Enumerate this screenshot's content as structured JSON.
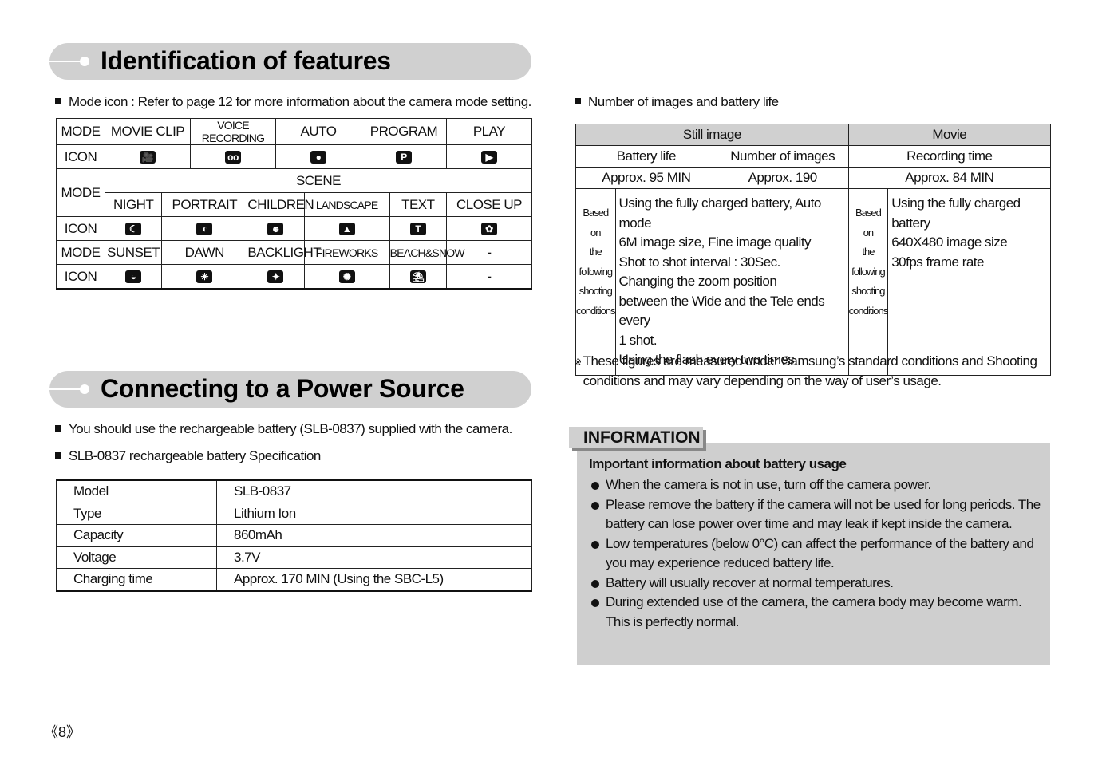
{
  "section1": {
    "title": "Identification of features",
    "bullet": "Mode icon : Refer to page 12 for more information about the camera mode setting."
  },
  "mode_table": {
    "row1": {
      "label": "MODE",
      "cells": [
        "MOVIE CLIP",
        "VOICE RECORDING",
        "AUTO",
        "PROGRAM",
        "PLAY"
      ]
    },
    "row2": {
      "label": "ICON",
      "icons": [
        "movie-clip-icon",
        "voice-recording-icon",
        "auto-camera-icon",
        "program-camera-icon",
        "play-icon"
      ]
    },
    "scene": {
      "label": "MODE",
      "header": "SCENE",
      "cells": [
        "NIGHT",
        "PORTRAIT",
        "CHILDREN",
        "LANDSCAPE",
        "TEXT",
        "CLOSE UP"
      ]
    },
    "row4": {
      "label": "ICON",
      "icons": [
        "night-icon",
        "portrait-icon",
        "children-icon",
        "landscape-icon",
        "text-icon",
        "close-up-icon"
      ]
    },
    "row5": {
      "label": "MODE",
      "cells": [
        "SUNSET",
        "DAWN",
        "BACKLIGHT",
        "FIREWORKS",
        "BEACH&SNOW",
        "-"
      ]
    },
    "row6": {
      "label": "ICON",
      "icons": [
        "sunset-icon",
        "dawn-icon",
        "backlight-icon",
        "fireworks-icon",
        "beach-snow-icon"
      ],
      "last": "-"
    }
  },
  "section2": {
    "title": "Connecting to a Power Source",
    "bullets": [
      "You should use the rechargeable battery (SLB-0837) supplied with the camera.",
      "SLB-0837 rechargeable battery Specification"
    ]
  },
  "spec_table": [
    [
      "Model",
      "SLB-0837"
    ],
    [
      "Type",
      "Lithium Ion"
    ],
    [
      "Capacity",
      "860mAh"
    ],
    [
      "Voltage",
      "3.7V"
    ],
    [
      "Charging time",
      "Approx. 170 MIN (Using the SBC-L5)"
    ]
  ],
  "battery": {
    "bullet": "Number of images and battery life",
    "still": "Still image",
    "movie": "Movie",
    "battery_life": "Battery life",
    "num_images": "Number of images",
    "recording_time": "Recording time",
    "battery_life_val": "Approx. 95 MIN",
    "num_images_val": "Approx. 190",
    "recording_val": "Approx. 84 MIN",
    "based_on": [
      "Based",
      "on",
      "the",
      "following",
      "shooting",
      "conditions"
    ],
    "still_conditions": [
      "Using the fully charged battery, Auto mode",
      "6M image size, Fine image quality",
      "Shot to shot interval : 30Sec.",
      "Changing the zoom position",
      "between the Wide and the Tele ends every",
      "1 shot.",
      "Using the flash every two times"
    ],
    "movie_conditions": [
      "Using the fully charged battery",
      "640X480 image size",
      "30fps frame rate"
    ]
  },
  "note": {
    "mark": "※",
    "text": "These figures are measured under Samsung’s standard conditions and Shooting conditions and may vary depending on the way of user’s usage."
  },
  "information": {
    "tab": "INFORMATION",
    "heading": "Important information about battery usage",
    "items": [
      "When the camera is not in use, turn off the camera power.",
      "Please remove the battery if the camera will not be used for long periods. The battery can lose power over time and may leak if kept inside the camera.",
      "Low temperatures (below 0°C) can affect the performance of the battery and you may experience reduced battery life.",
      "Battery will usually recover at normal temperatures.",
      "During extended use of the camera, the camera body may become warm. This is perfectly normal."
    ]
  },
  "page_number": "《8》"
}
